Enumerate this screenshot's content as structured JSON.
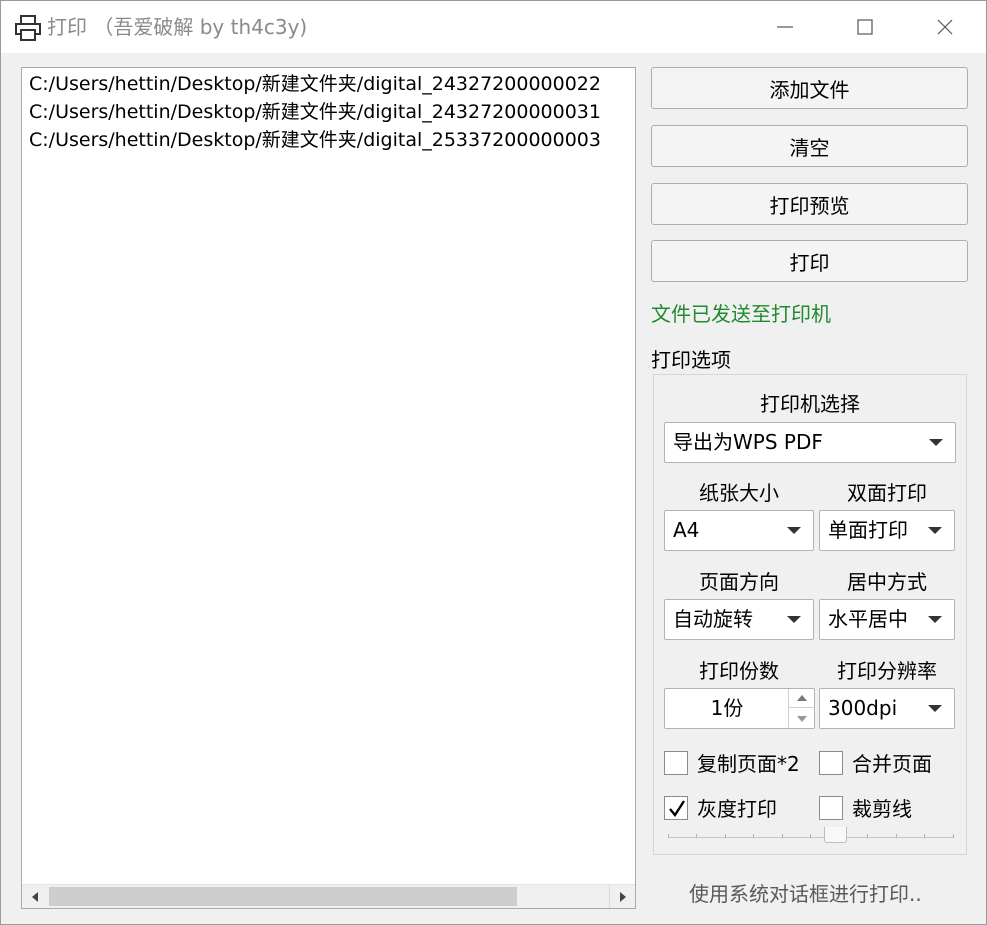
{
  "window": {
    "title": "打印 （吾爱破解 by th4c3y)"
  },
  "file_list": {
    "items": [
      "C:/Users/hettin/Desktop/新建文件夹/digital_24327200000022",
      "C:/Users/hettin/Desktop/新建文件夹/digital_24327200000031",
      "C:/Users/hettin/Desktop/新建文件夹/digital_25337200000003"
    ]
  },
  "actions": {
    "add_file": "添加文件",
    "clear": "清空",
    "print_preview": "打印预览",
    "print": "打印"
  },
  "status": {
    "text": "文件已发送至打印机",
    "color": "#1f8a2e"
  },
  "options": {
    "section_label": "打印选项",
    "printer_label": "打印机选择",
    "printer_value": "导出为WPS PDF",
    "paper_size_label": "纸张大小",
    "paper_size_value": "A4",
    "duplex_label": "双面打印",
    "duplex_value": "单面打印",
    "orientation_label": "页面方向",
    "orientation_value": "自动旋转",
    "centering_label": "居中方式",
    "centering_value": "水平居中",
    "copies_label": "打印份数",
    "copies_value": "1份",
    "resolution_label": "打印分辨率",
    "resolution_value": "300dpi",
    "checkboxes": {
      "duplicate_page": {
        "label": "复制页面*2",
        "checked": false
      },
      "merge_pages": {
        "label": "合并页面",
        "checked": false
      },
      "grayscale": {
        "label": "灰度打印",
        "checked": true
      },
      "crop_marks": {
        "label": "裁剪线",
        "checked": false
      }
    }
  },
  "system_dialog_link": "使用系统对话框进行打印.."
}
